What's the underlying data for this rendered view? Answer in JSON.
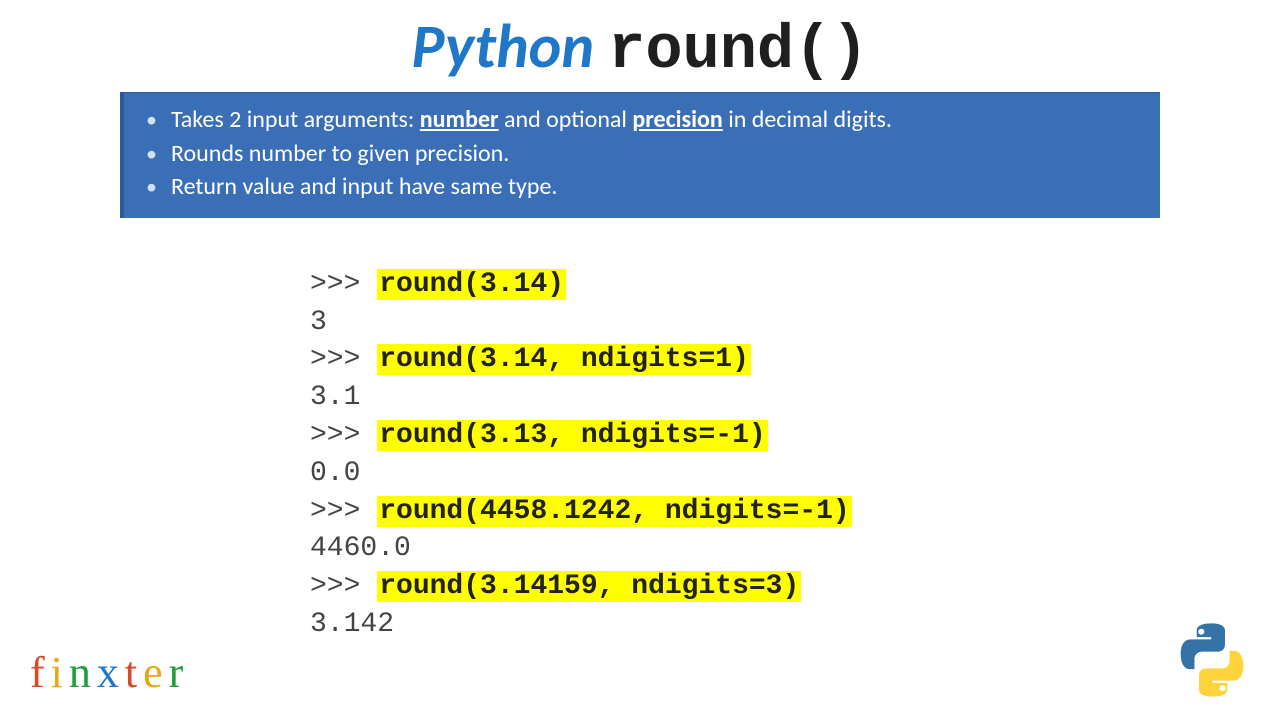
{
  "title": {
    "word1": "Python",
    "word2": "round()"
  },
  "bullets": {
    "b1_pre": "Takes 2 input arguments: ",
    "b1_k1": "number",
    "b1_mid": " and optional ",
    "b1_k2": "precision",
    "b1_post": " in decimal digits.",
    "b2": "Rounds number to given precision.",
    "b3": "Return value and input have same type."
  },
  "code": {
    "prompt": ">>> ",
    "l1_call": "round(3.14)",
    "l1_out": "3",
    "l2_call": "round(3.14, ndigits=1)",
    "l2_out": "3.1",
    "l3_call": "round(3.13, ndigits=-1)",
    "l3_out": "0.0",
    "l4_call": "round(4458.1242, ndigits=-1)",
    "l4_out": "4460.0",
    "l5_call": "round(3.14159, ndigits=3)",
    "l5_out": "3.142"
  },
  "brand": {
    "l1": "f",
    "l2": "i",
    "l3": "n",
    "l4": "x",
    "l5": "t",
    "l6": "e",
    "l7": "r"
  }
}
